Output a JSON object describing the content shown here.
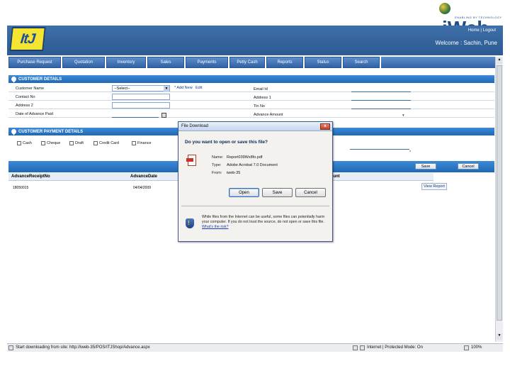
{
  "brand": {
    "name": "iWeb",
    "tagline": "ENABLING BY TECHNOLOGY"
  },
  "header": {
    "logo_text": "ItJ",
    "links_home": "Home",
    "links_sep": " | ",
    "links_logout": "Logout",
    "welcome": "Welcome : Sachin, Pune"
  },
  "nav": {
    "tabs": [
      {
        "label": "Purchase Request"
      },
      {
        "label": "Quotation"
      },
      {
        "label": "Inventory"
      },
      {
        "label": "Sales"
      },
      {
        "label": "Payments"
      },
      {
        "label": "Petty Cash"
      },
      {
        "label": "Reports"
      },
      {
        "label": "Status"
      },
      {
        "label": "Search"
      }
    ]
  },
  "customer_details": {
    "section_title": "CUSTOMER DETAILS",
    "customer_name_label": "Customer Name",
    "customer_select_value": "--Select--",
    "add_new_label": "* Add New",
    "edit_label": "Edit",
    "contact_no_label": "Contact No",
    "address1_label": "Address 1",
    "address2_label": "Address 2",
    "date_label": "Date of Advance Paid",
    "email_label": "Email Id",
    "address_right_label": "Address 1",
    "tin_label": "Tin No",
    "advance_amount_label": "Advance Amount"
  },
  "payment_details": {
    "section_title": "CUSTOMER PAYMENT DETAILS",
    "options": [
      {
        "label": "Cash"
      },
      {
        "label": "Cheque"
      },
      {
        "label": "Draft"
      },
      {
        "label": "Credit Card"
      },
      {
        "label": "Finance"
      }
    ],
    "save_label": "Save",
    "cancel_label": "Cancel"
  },
  "table": {
    "headers": [
      "AdvanceReceiptNo",
      "AdvanceDate",
      "AdvanceAmount"
    ],
    "rows": [
      {
        "receipt": "18050015",
        "date": "04/04/2009"
      }
    ],
    "view_report_label": "View Report"
  },
  "dialog": {
    "title": "File Download",
    "close_label": "x",
    "question": "Do you want to open or save this file?",
    "name_key": "Name:",
    "name_val": "Report039Wx8fo.pdf",
    "type_key": "Type:",
    "type_val": "Adobe Acrobat 7.0 Document",
    "from_key": "From:",
    "from_val": "iweb-35",
    "open_label": "Open",
    "save_label": "Save",
    "cancel_label": "Cancel",
    "warning": "While files from the Internet can be useful, some files can potentially harm your computer. If you do not trust the source, do not open or save this file. ",
    "risk_link": "What's the risk?"
  },
  "statusbar": {
    "text": "Start downloading from site: http://iweb-35/POS/ITJShop/Advance.aspx",
    "zone": "Internet | Protected Mode: On",
    "zoom": "100%"
  }
}
